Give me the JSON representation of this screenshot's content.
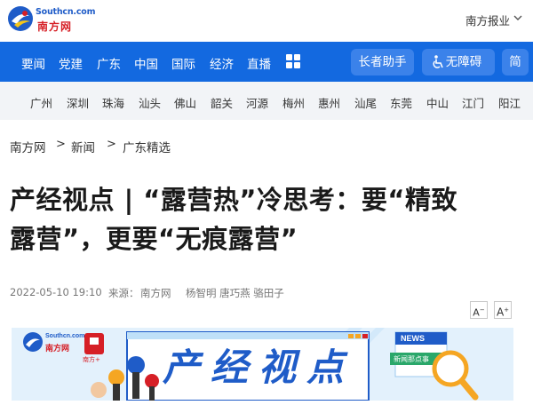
{
  "header": {
    "logo_en": "Southcn.com",
    "logo_cn": "南方网",
    "right_link": "南方报业"
  },
  "nav": {
    "items": [
      "要闻",
      "党建",
      "广东",
      "中国",
      "国际",
      "经济",
      "直播"
    ],
    "grid_icon": "grid-icon",
    "buttons": {
      "helper": "长者助手",
      "accessibility": "无障碍",
      "simplified": "简"
    }
  },
  "cities": [
    "广州",
    "深圳",
    "珠海",
    "汕头",
    "佛山",
    "韶关",
    "河源",
    "梅州",
    "惠州",
    "汕尾",
    "东莞",
    "中山",
    "江门",
    "阳江"
  ],
  "breadcrumb": [
    "南方网",
    "新闻",
    "广东精选"
  ],
  "breadcrumb_separator": ">",
  "article": {
    "title_line1": "产经视点 | “露营热”冷思考：要“精致",
    "title_line2": "露营”，更要“无痕露营”",
    "date": "2022-05-10 19:10",
    "source_label": "来源：",
    "source": "南方网",
    "authors": "杨智明 唐巧燕 骆田子"
  },
  "font_controls": {
    "decrease": "A",
    "increase": "A"
  },
  "banner": {
    "logo_en": "Southcn.com",
    "logo_cn": "南方网",
    "app_badge": "南方+",
    "headline": "产经视点",
    "tag_news": "NEWS",
    "tag_story": "新闻那点事"
  },
  "colors": {
    "brand_blue": "#1369e0",
    "brand_red": "#d61f26",
    "city_bar_bg": "#f2f4f7"
  }
}
